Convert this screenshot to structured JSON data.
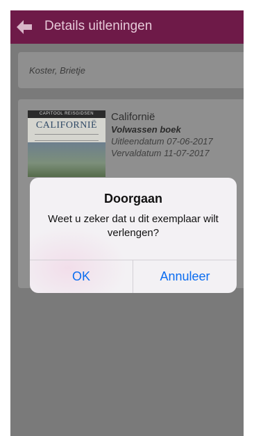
{
  "header": {
    "back_icon": "back-arrow-icon",
    "title": "Details uitleningen",
    "color": "#6e1a48"
  },
  "patron": {
    "name": "Koster, Brietje"
  },
  "loan": {
    "cover": {
      "band_text": "CAPITOOL REISGIDSEN",
      "title_text": "CALIFORNIË"
    },
    "title": "Californië",
    "type": "Volwassen boek",
    "loan_date": "Uitleendatum 07-06-2017",
    "due_date": "Vervaldatum 11-07-2017"
  },
  "dialog": {
    "title": "Doorgaan",
    "message": "Weet u zeker dat u dit exemplaar wilt verlengen?",
    "ok_label": "OK",
    "cancel_label": "Annuleer",
    "button_color": "#0a6cf0"
  }
}
